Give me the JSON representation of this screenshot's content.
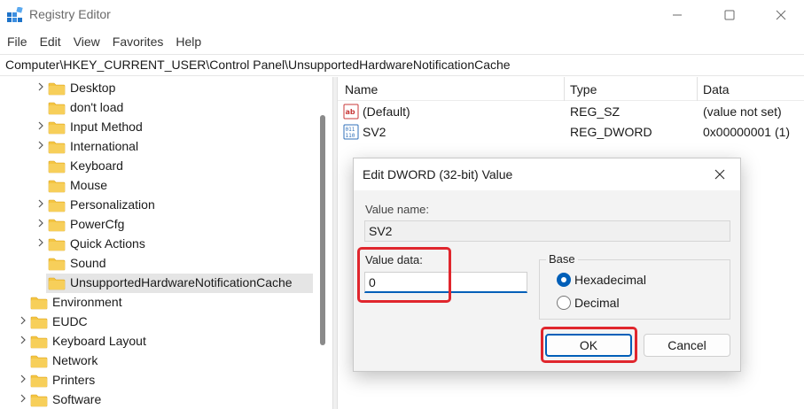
{
  "window": {
    "title": "Registry Editor"
  },
  "menu": [
    "File",
    "Edit",
    "View",
    "Favorites",
    "Help"
  ],
  "address": "Computer\\HKEY_CURRENT_USER\\Control Panel\\UnsupportedHardwareNotificationCache",
  "tree": [
    {
      "label": "Desktop",
      "expandable": true,
      "level": 2
    },
    {
      "label": "don't load",
      "expandable": false,
      "level": 2
    },
    {
      "label": "Input Method",
      "expandable": true,
      "level": 2
    },
    {
      "label": "International",
      "expandable": true,
      "level": 2
    },
    {
      "label": "Keyboard",
      "expandable": false,
      "level": 2
    },
    {
      "label": "Mouse",
      "expandable": false,
      "level": 2
    },
    {
      "label": "Personalization",
      "expandable": true,
      "level": 2
    },
    {
      "label": "PowerCfg",
      "expandable": true,
      "level": 2
    },
    {
      "label": "Quick Actions",
      "expandable": true,
      "level": 2
    },
    {
      "label": "Sound",
      "expandable": false,
      "level": 2
    },
    {
      "label": "UnsupportedHardwareNotificationCache",
      "expandable": false,
      "level": 2,
      "selected": true
    },
    {
      "label": "Environment",
      "expandable": false,
      "level": 1
    },
    {
      "label": "EUDC",
      "expandable": true,
      "level": 1
    },
    {
      "label": "Keyboard Layout",
      "expandable": true,
      "level": 1
    },
    {
      "label": "Network",
      "expandable": false,
      "level": 1
    },
    {
      "label": "Printers",
      "expandable": true,
      "level": 1
    },
    {
      "label": "Software",
      "expandable": true,
      "level": 1
    }
  ],
  "list": {
    "columns": [
      "Name",
      "Type",
      "Data"
    ],
    "rows": [
      {
        "name": "(Default)",
        "type": "REG_SZ",
        "data": "(value not set)",
        "icon": "string-value-icon"
      },
      {
        "name": "SV2",
        "type": "REG_DWORD",
        "data": "0x00000001 (1)",
        "icon": "binary-value-icon"
      }
    ]
  },
  "dialog": {
    "title": "Edit DWORD (32-bit) Value",
    "value_name_label": "Value name:",
    "value_name": "SV2",
    "value_data_label": "Value data:",
    "value_data": "0",
    "base_label": "Base",
    "hex_label": "Hexadecimal",
    "dec_label": "Decimal",
    "base_selected": "Hexadecimal",
    "ok_label": "OK",
    "cancel_label": "Cancel"
  },
  "colors": {
    "accent": "#005fb8",
    "highlight": "#e0262d",
    "folder": "#f4c542"
  }
}
